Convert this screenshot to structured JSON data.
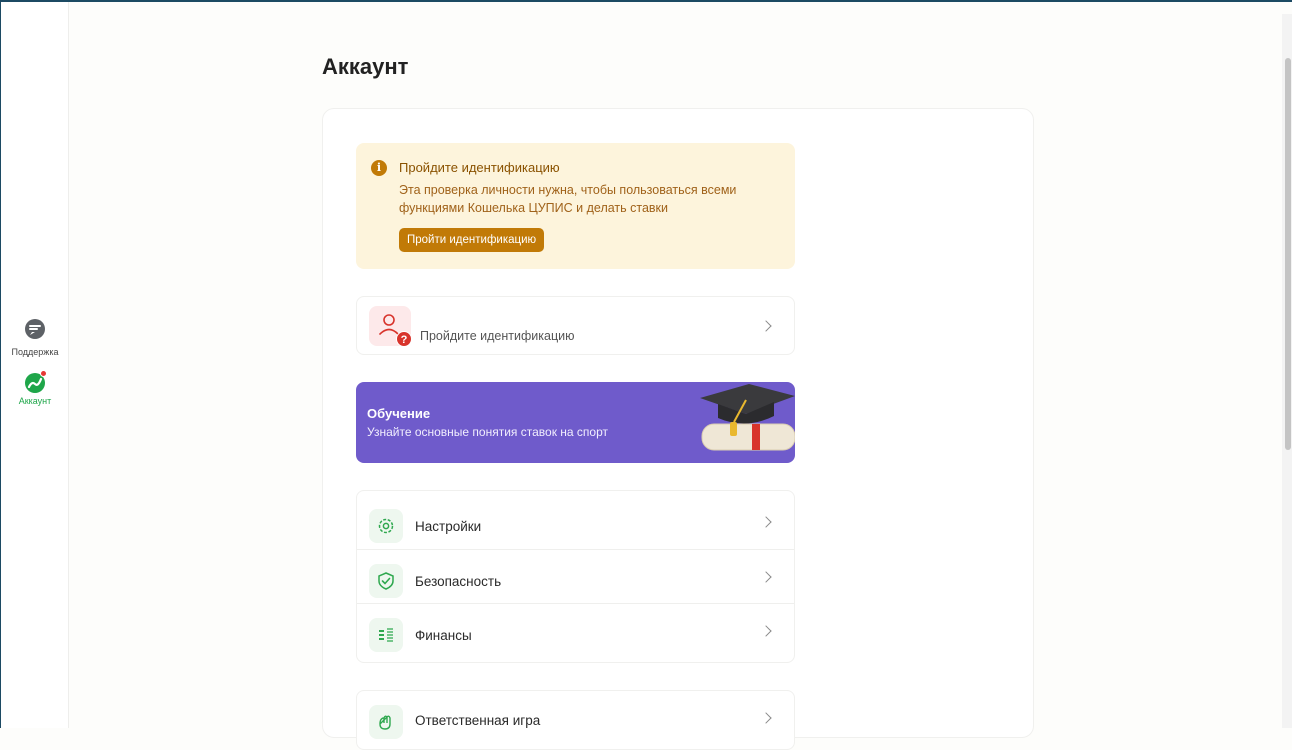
{
  "page": {
    "title": "Аккаунт"
  },
  "sidebar": {
    "support": {
      "label": "Поддержка",
      "icon": "chat-icon"
    },
    "account": {
      "label": "Аккаунт",
      "icon": "account-icon",
      "badge_color": "#e53935"
    }
  },
  "identification_alert": {
    "title": "Пройдите идентификацию",
    "text": "Эта проверка личности нужна, чтобы пользоваться всеми функциями Кошелька ЦУПИС и делать ставки",
    "button_label": "Пройти идентификацию",
    "icon": "info-icon",
    "accent_color": "#c17a07"
  },
  "identification_row": {
    "label": "Пройдите идентификацию",
    "badge": "?",
    "icon": "user-icon"
  },
  "promo": {
    "title": "Обучение",
    "subtitle": "Узнайте основные понятия ставок на спорт",
    "background_color": "#6f5bcb",
    "image": "graduation-cap-diploma"
  },
  "menu": {
    "items": [
      {
        "label": "Настройки",
        "icon": "gear-icon"
      },
      {
        "label": "Безопасность",
        "icon": "shield-check-icon"
      },
      {
        "label": "Финансы",
        "icon": "finance-icon"
      }
    ]
  },
  "menu2": {
    "items": [
      {
        "label": "Ответственная игра",
        "icon": "hand-heart-icon"
      }
    ]
  },
  "colors": {
    "brand_green": "#1fa64a"
  }
}
